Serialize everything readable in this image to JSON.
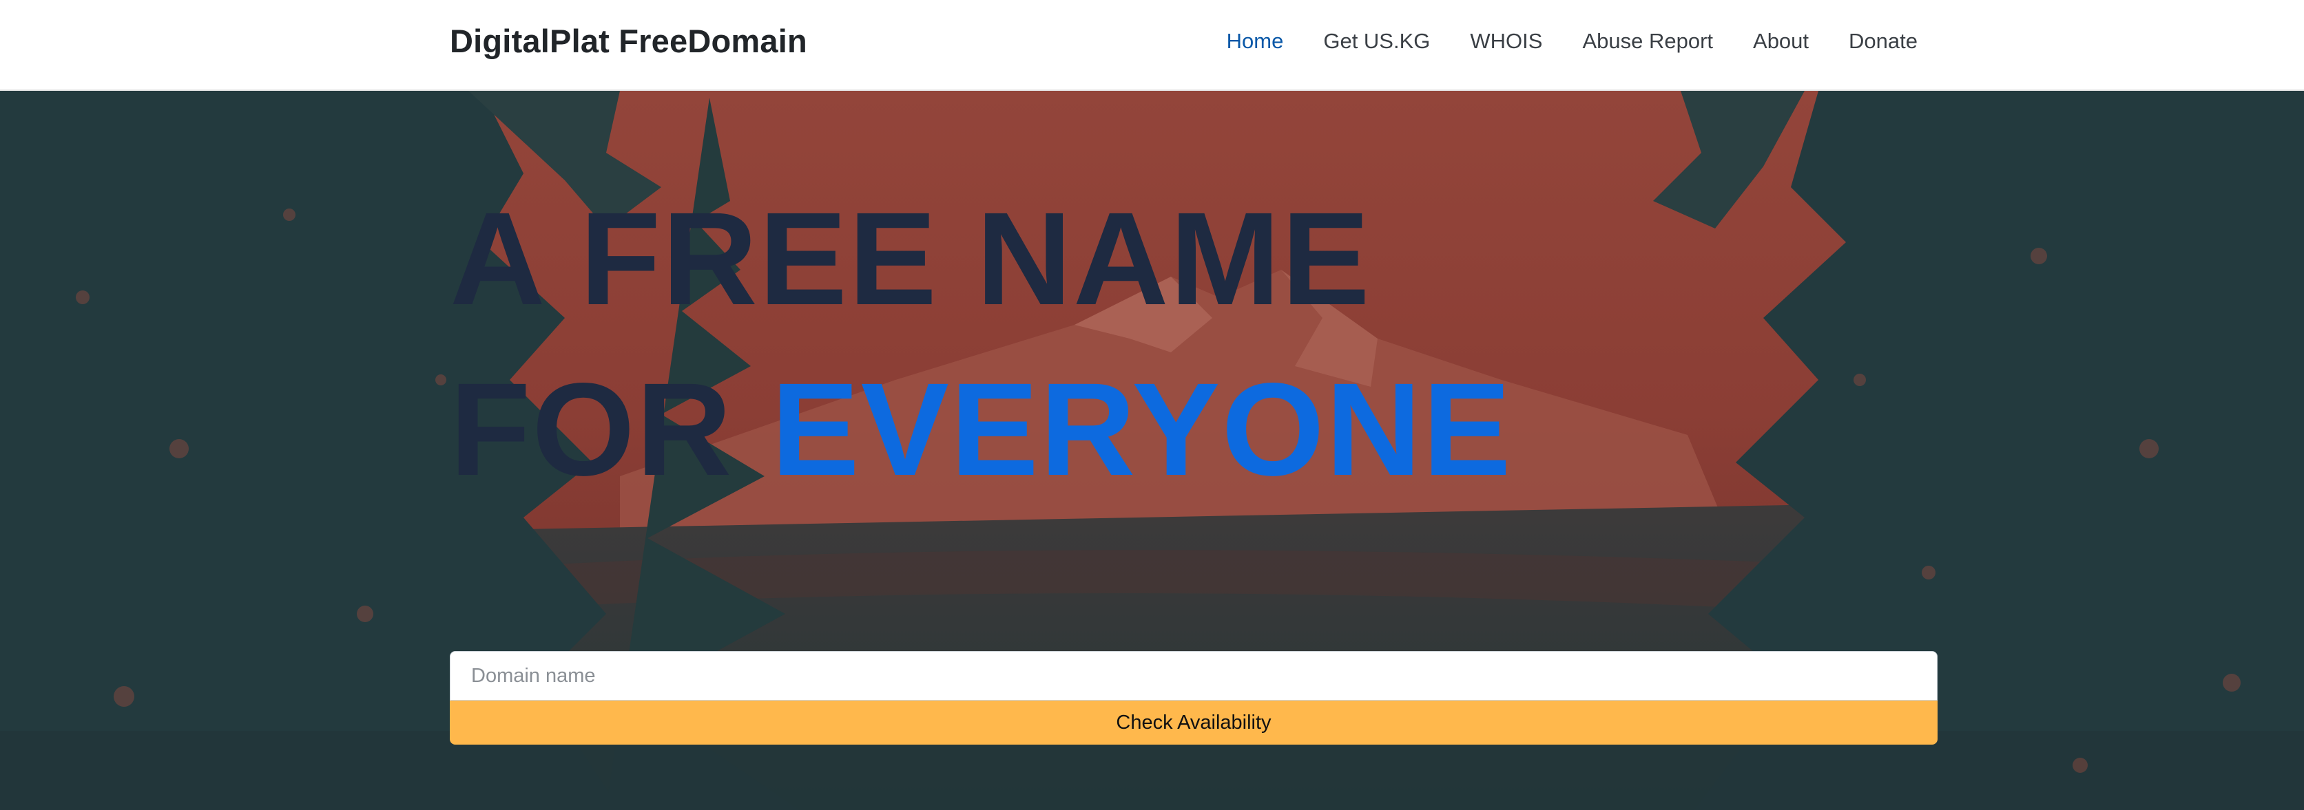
{
  "header": {
    "brand": "DigitalPlat FreeDomain",
    "nav": [
      {
        "label": "Home",
        "active": true
      },
      {
        "label": "Get US.KG",
        "active": false
      },
      {
        "label": "WHOIS",
        "active": false
      },
      {
        "label": "Abuse Report",
        "active": false
      },
      {
        "label": "About",
        "active": false
      },
      {
        "label": "Donate",
        "active": false
      }
    ]
  },
  "hero": {
    "line1": "A FREE NAME",
    "line2_prefix": "FOR",
    "line2_accent": "EVERYONE",
    "background_image": "forest-mountain-photo (red duotone)"
  },
  "search": {
    "placeholder": "Domain name",
    "value": "",
    "button_label": "Check Availability"
  },
  "colors": {
    "title_dark": "#1e2a41",
    "title_accent": "#0d6adf",
    "nav_active": "#0a58a8",
    "button_bg": "#ffb84c",
    "hero_red": "#8a3f36",
    "hero_teal": "#233a3e"
  }
}
